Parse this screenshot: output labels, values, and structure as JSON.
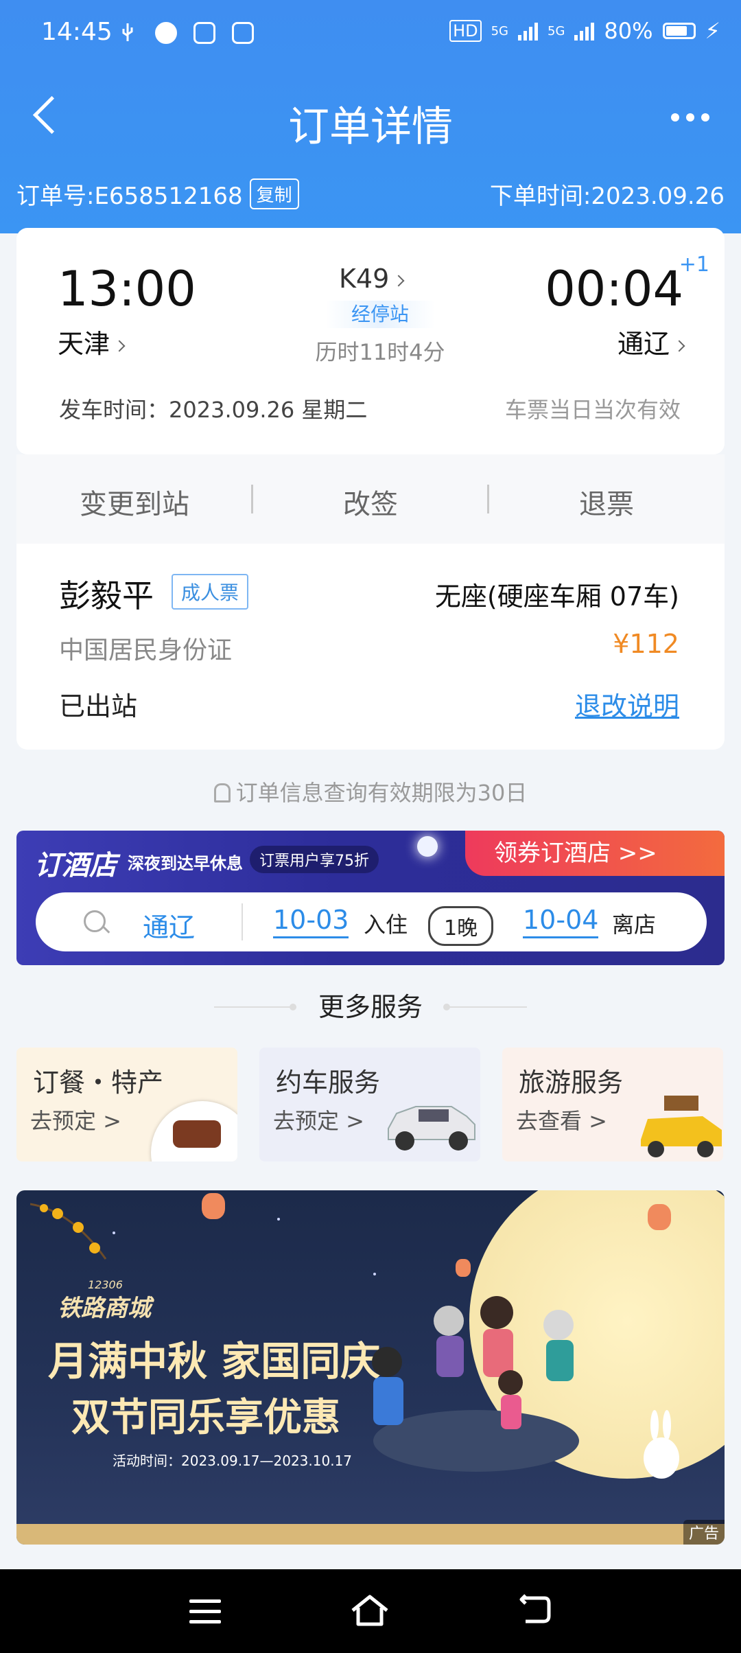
{
  "status_bar": {
    "time": "14:45",
    "network_1": "5G",
    "network_2": "5G",
    "battery": "80%",
    "hd_label": "HD"
  },
  "nav": {
    "title": "订单详情"
  },
  "order": {
    "number": "订单号:E658512168",
    "copy_label": "复制",
    "created": "下单时间:2023.09.26"
  },
  "train": {
    "dep_time": "13:00",
    "dep_station": "天津",
    "train_no": "K49",
    "stops_label": "经停站",
    "duration": "历时11时4分",
    "arr_time": "00:04",
    "arr_station": "通辽",
    "next_day": "+1",
    "dep_date": "发车时间：2023.09.26 星期二",
    "validity": "车票当日当次有效"
  },
  "actions": [
    "变更到站",
    "改签",
    "退票"
  ],
  "passenger": {
    "name": "彭毅平",
    "ticket_type": "成人票",
    "seat": "无座(硬座车厢 07车)",
    "id_type": "中国居民身份证",
    "price": "¥112",
    "status": "已出站",
    "rules_link": "退改说明"
  },
  "notice": "订单信息查询有效期限为30日",
  "hotel": {
    "logo": "订酒店",
    "subtitle": "深夜到达早休息",
    "promo": "订票用户享75折",
    "cta": "领券订酒店 >>",
    "city": "通辽",
    "checkin_date": "10-03",
    "checkin_label": "入住",
    "nights": "1晚",
    "checkout_date": "10-04",
    "checkout_label": "离店"
  },
  "more_services": {
    "title": "更多服务",
    "items": [
      {
        "title": "订餐・特产",
        "link": "去预定 >"
      },
      {
        "title": "约车服务",
        "link": "去预定 >"
      },
      {
        "title": "旅游服务",
        "link": "去查看 >"
      }
    ]
  },
  "ad": {
    "brand": "铁路商城",
    "brand_small": "12306",
    "headline1": "月满中秋 家国同庆",
    "headline2": "双节同乐享优惠",
    "date": "活动时间：2023.09.17—2023.10.17",
    "tag": "广告"
  },
  "colors": {
    "primary": "#3b95f3",
    "price": "#f08a24",
    "link": "#2c8ce8",
    "hotel_cta": "#ee3a5c"
  }
}
